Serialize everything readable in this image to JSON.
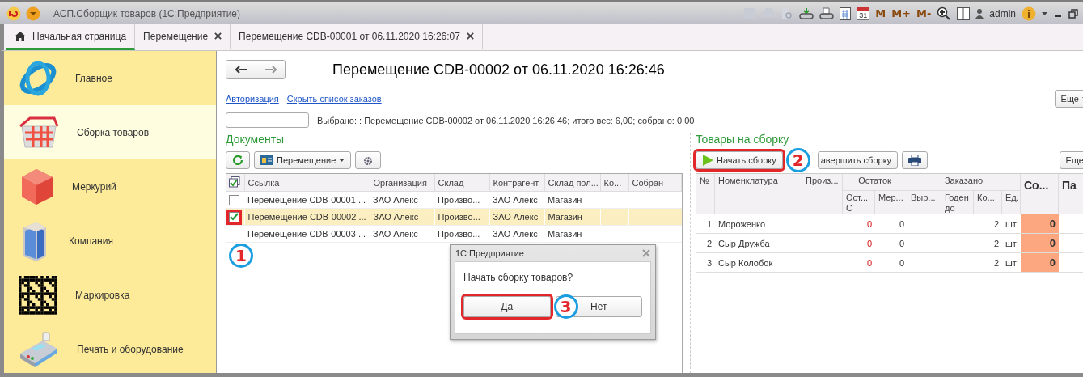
{
  "window": {
    "title": "АСП.Сборщик товаров (1С:Предприятие)",
    "calendar_day": "31",
    "memory_buttons": [
      "M",
      "M+",
      "M-"
    ],
    "user": "admin"
  },
  "tabs": [
    {
      "label": "Начальная страница",
      "kind": "home",
      "selected": true,
      "closable": false
    },
    {
      "label": "Перемещение",
      "kind": "form",
      "selected": false,
      "closable": true
    },
    {
      "label": "Перемещение CDB-00001 от 06.11.2020 16:26:07",
      "kind": "form",
      "selected": false,
      "closable": true
    }
  ],
  "sidebar": {
    "items": [
      {
        "label": "Главное",
        "kind": "main",
        "selected": false
      },
      {
        "label": "Сборка товаров",
        "kind": "basket",
        "selected": true
      },
      {
        "label": "Меркурий",
        "kind": "cube",
        "selected": false
      },
      {
        "label": "Компания",
        "kind": "building",
        "selected": false
      },
      {
        "label": "Маркировка",
        "kind": "datamatrix",
        "selected": false
      },
      {
        "label": "Печать и оборудование",
        "kind": "terminal",
        "selected": false
      }
    ]
  },
  "document": {
    "title": "Перемещение CDB-00002 от 06.11.2020 16:26:46",
    "links": [
      "Авторизация",
      "Скрыть список заказов"
    ],
    "more_button": "Еще",
    "selection_text": "Выбрано: : Перемещение CDB-00002 от 06.11.2020 16:26:46; итого вес: 6,00; собрано: 0,00"
  },
  "documents": {
    "heading": "Документы",
    "type_button": "Перемещение",
    "columns": [
      "Ссылка",
      "Организация",
      "Склад",
      "Контрагент",
      "Склад пол...",
      "Ко...",
      "Собран"
    ],
    "rows": [
      {
        "checked": false,
        "selected": false,
        "cells": [
          "Перемещение CDB-00001 ...",
          "ЗАО Алекс",
          "Произво...",
          "ЗАО Алекс",
          "Магазин"
        ]
      },
      {
        "checked": true,
        "selected": true,
        "highlighted": true,
        "callout": "1",
        "cells": [
          "Перемещение CDB-00002 ...",
          "ЗАО Алекс",
          "Произво...",
          "ЗАО Алекс",
          "Магазин"
        ]
      },
      {
        "selected": false,
        "cells": [
          "Перемещение CDB-00003 ...",
          "ЗАО Алекс",
          "Произво...",
          "ЗАО Алекс",
          "Магазин"
        ]
      }
    ]
  },
  "goods": {
    "heading": "Товары на сборку",
    "start_button": {
      "label": "Начать сборку",
      "highlighted": true,
      "callout": "2"
    },
    "finish_button": "авершить сборку",
    "more_button": "Еще",
    "columns": [
      {
        "label": "№"
      },
      {
        "label": "Номенклатура"
      },
      {
        "label": "Произ..."
      },
      {
        "label": "Остаток",
        "children": [
          {
            "label": "Ост... С"
          },
          {
            "label": "Мер..."
          }
        ]
      },
      {
        "label": "Заказано",
        "children": [
          {
            "label": "Выр..."
          },
          {
            "label": "Годен до"
          },
          {
            "label": "Ко..."
          },
          {
            "label": "Ед."
          }
        ]
      },
      {
        "label": "Со...",
        "bold": true
      },
      {
        "label": "Па",
        "bold": true
      }
    ],
    "rows": [
      {
        "number": "1",
        "name": "Мороженко",
        "stock": "0",
        "stock_short": true,
        "merc": "0",
        "qty": "2",
        "unit": "шт",
        "collected": "0"
      },
      {
        "number": "2",
        "name": "Сыр Дружба",
        "stock": "0",
        "stock_short": true,
        "merc": "0",
        "qty": "2",
        "unit": "шт",
        "collected": "0"
      },
      {
        "number": "3",
        "name": "Сыр Колобок",
        "stock": "0",
        "stock_short": true,
        "merc": "0",
        "qty": "2",
        "unit": "шт",
        "collected": "0"
      }
    ]
  },
  "dialog": {
    "title": "1С:Предприятие",
    "message": "Начать сборку товаров?",
    "buttons": [
      {
        "label": "Да",
        "highlighted": true,
        "callout": "3"
      },
      {
        "label": "Нет",
        "highlighted": false
      }
    ]
  }
}
